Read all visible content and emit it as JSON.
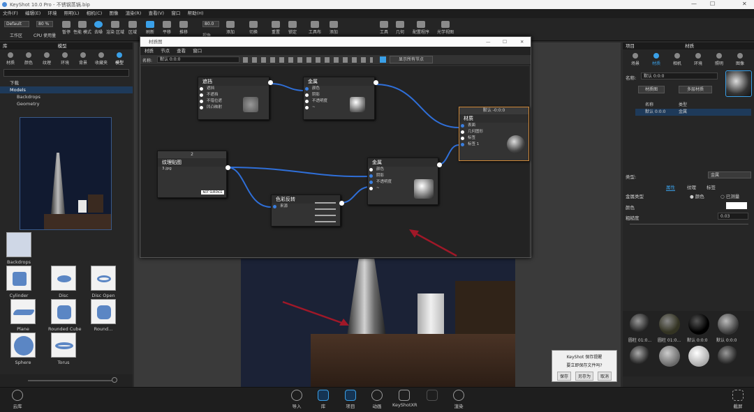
{
  "app": {
    "title": "KeyShot 10.0 Pro  -  不锈钢蒸锅.bip",
    "min": "—",
    "max": "☐",
    "close": "✕"
  },
  "menu": [
    "文件(F)",
    "编辑(E)",
    "环境",
    "照明(L)",
    "相机(C)",
    "图像",
    "渲染(R)",
    "查看(V)",
    "窗口",
    "帮助(H)"
  ],
  "toolbar": {
    "workspace_value": "Default",
    "workspace_label": "工作区",
    "cpu_value": "80 %",
    "cpu_label": "CPU 使用量",
    "pause": "暂停",
    "perf_mode": "性能\n模式",
    "denoise": "去噪",
    "render_region": "渲染\n区域",
    "region": "区域",
    "refresh": "刷新",
    "translate": "平移",
    "push": "推移",
    "fov_value": "80.0",
    "fov_label": "视角",
    "add": "添加",
    "switch": "切换",
    "reset": "重置",
    "lock": "锁定",
    "tool": "工具",
    "geometry": "几何",
    "config_program": "配置程序",
    "studio": "光学视图",
    "add2": "添加",
    "cut": "工具布",
    "lighting": "几何"
  },
  "library": {
    "title_left": "库",
    "title": "模型",
    "tabs": [
      "材质",
      "颜色",
      "纹理",
      "环境",
      "背景",
      "收藏夹",
      "模型"
    ],
    "tree": [
      "下载",
      "Models",
      "Backdrops",
      "Geometry"
    ],
    "thumbs": [
      {
        "label": "Backdrops"
      },
      {
        "label": "Cylinder"
      },
      {
        "label": "Disc"
      },
      {
        "label": "Disc Open"
      },
      {
        "label": "Plane"
      },
      {
        "label": "Rounded Cube"
      },
      {
        "label": "Round..."
      },
      {
        "label": "Sphere"
      },
      {
        "label": "Torus"
      }
    ]
  },
  "material_graph": {
    "title": "材质图",
    "menu": [
      "材质",
      "节点",
      "查看",
      "窗口"
    ],
    "name_label": "名称:",
    "name_value": "默认 0:0:0",
    "show_all": "显示所有节点",
    "nodes": {
      "occlusion": {
        "title": "遮挡",
        "pins": [
          "遮挡",
          "不遮挡",
          "不错位遮",
          "凹凸映射"
        ]
      },
      "metal1": {
        "title": "金属",
        "pins": [
          "颜色",
          "阴影",
          "不透明度",
          "~"
        ]
      },
      "texture": {
        "badge": "2",
        "title": "纹理贴图",
        "file": "3.jpg",
        "tag": "NOT SURFACE"
      },
      "color_invert": {
        "title": "色彩反转",
        "pins": [
          "来源"
        ]
      },
      "metal2": {
        "title": "金属",
        "pins": [
          "颜色",
          "阴影",
          "不透明度",
          "~"
        ]
      },
      "material": {
        "badge": "默认 -0:0:0",
        "title": "材质",
        "pins": [
          "表面",
          "几何图形",
          "标签",
          "标签 1"
        ]
      }
    }
  },
  "project": {
    "title_left": "项目",
    "title": "材质",
    "tabs": [
      "场景",
      "材质",
      "相机",
      "环境",
      "照明",
      "图像"
    ],
    "name_label": "名称:",
    "name_value": "默认 0:0:0",
    "btn_graph": "材质图",
    "btn_multi": "多层材质",
    "cols": [
      "名称",
      "类型"
    ],
    "row": {
      "name": "默认 0:0:0",
      "type": "金属"
    },
    "type_label": "类型:",
    "type_value": "金属",
    "subtabs": [
      "属性",
      "纹理",
      "标签"
    ],
    "metal_type_label": "金属类型",
    "opt_color": "颜色",
    "opt_measured": "已测量",
    "color_label": "颜色",
    "roughness_label": "粗糙度",
    "roughness_value": "0.03",
    "swatches": [
      "圆柱 01:0...",
      "圆柱 01:0...",
      "默认 0:0:0",
      "默认 0:0:0",
      "",
      "",
      "",
      ""
    ]
  },
  "dialog": {
    "title": "KeyShot 保存提醒",
    "message": "要立即保存文件吗?",
    "save": "保存",
    "save_as": "另存为",
    "cancel": "取消"
  },
  "bottom": {
    "cloud": "云库",
    "import": "导入",
    "library": "库",
    "project": "项目",
    "animation": "动画",
    "xr": "KeyShotXR",
    "render": "渲染",
    "screenshot": "截屏"
  },
  "colors": {
    "accent": "#3aa0e8",
    "wire": "#2f6fd8",
    "arrow": "#a01828"
  }
}
